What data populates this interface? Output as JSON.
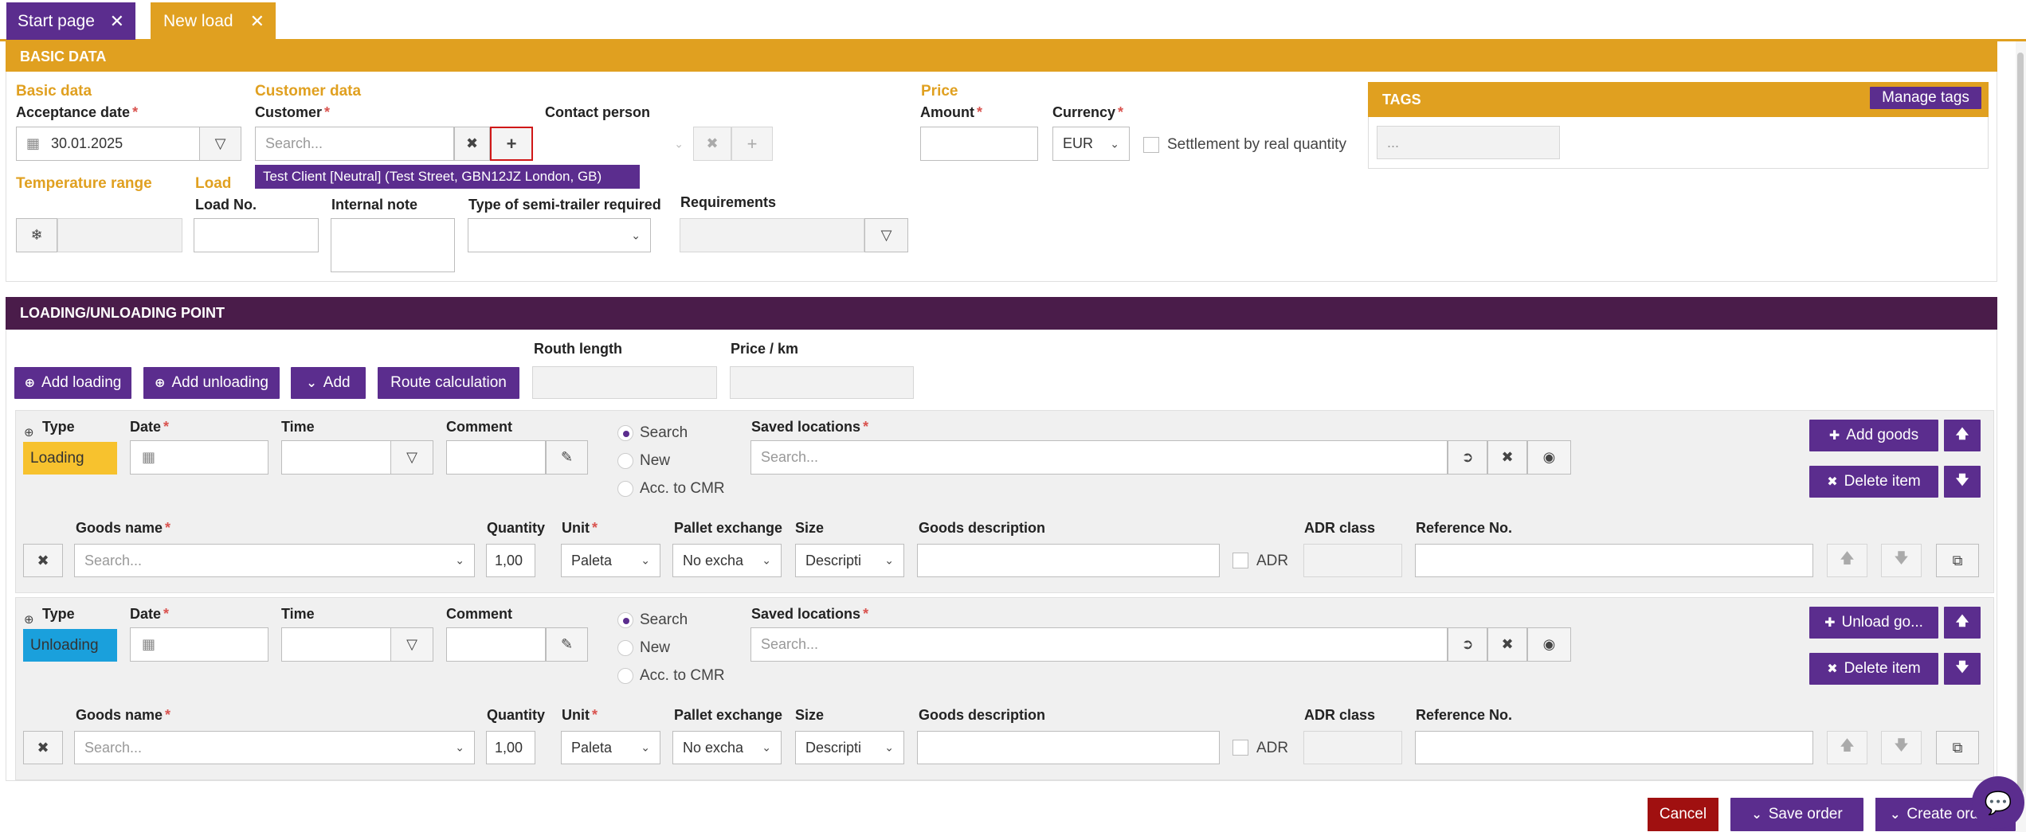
{
  "tabs": [
    {
      "label": "Start page",
      "color": "#5b2d8e"
    },
    {
      "label": "New load",
      "color": "#e0a020"
    }
  ],
  "basic": {
    "header": "BASIC DATA",
    "basic_data_title": "Basic data",
    "acceptance_date_label": "Acceptance date",
    "acceptance_date_value": "30.01.2025",
    "customer_data_title": "Customer data",
    "customer_label": "Customer",
    "customer_placeholder": "Search...",
    "customer_suggestion": "Test Client [Neutral] (Test Street, GBN12JZ London, GB)",
    "contact_person_label": "Contact person",
    "price_title": "Price",
    "amount_label": "Amount",
    "currency_label": "Currency",
    "currency_value": "EUR",
    "settlement_label": "Settlement by real quantity",
    "tags_header": "TAGS",
    "manage_tags_label": "Manage tags",
    "tags_placeholder": "...",
    "temperature_title": "Temperature range",
    "load_title": "Load",
    "load_no_label": "Load No.",
    "internal_note_label": "Internal note",
    "semitrailer_label": "Type of semi-trailer required",
    "requirements_label": "Requirements"
  },
  "loading": {
    "header": "LOADING/UNLOADING POINT",
    "add_loading_label": "Add loading",
    "add_unloading_label": "Add unloading",
    "add_label": "Add",
    "route_calc_label": "Route calculation",
    "route_length_label": "Routh length",
    "price_per_km_label": "Price / km",
    "col_type": "Type",
    "col_date": "Date",
    "col_time": "Time",
    "col_comment": "Comment",
    "radio_search": "Search",
    "radio_new": "New",
    "radio_cmr": "Acc. to CMR",
    "saved_locations_label": "Saved locations",
    "search_placeholder": "Search...",
    "goods_name_label": "Goods name",
    "quantity_label": "Quantity",
    "unit_label": "Unit",
    "pallet_label": "Pallet exchange",
    "size_label": "Size",
    "goods_desc_label": "Goods description",
    "adr_class_label": "ADR class",
    "reference_label": "Reference No.",
    "adr_label": "ADR",
    "quantity_value": "1,00",
    "unit_value": "Paleta",
    "pallet_value": "No excha",
    "size_value": "Descripti",
    "delete_item_label": "Delete item",
    "stop1_type": "Loading",
    "stop1_action": "Add goods",
    "stop2_type": "Unloading",
    "stop2_action": "Unload go..."
  },
  "footer": {
    "cancel_label": "Cancel",
    "save_label": "Save order",
    "create_label": "Create ord"
  },
  "colors": {
    "purple": "#5b2d8e",
    "dark_purple": "#4a1c4a",
    "orange": "#e0a020",
    "loading": "#f7c22e",
    "unloading": "#1aa0dc",
    "cancel": "#a01010"
  }
}
